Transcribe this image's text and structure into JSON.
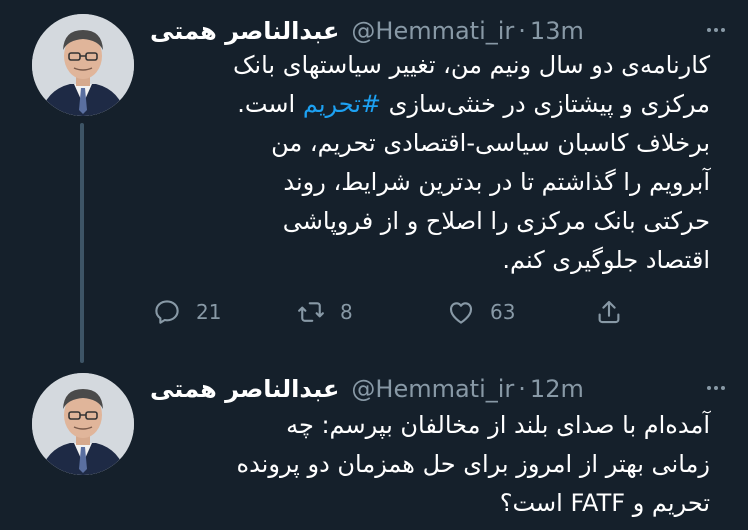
{
  "colors": {
    "background": "#15202b",
    "secondary_text": "#8899a6",
    "hashtag": "#1da1f2",
    "thread_line": "#3d5466"
  },
  "tweets": [
    {
      "display_name": "عبدالناصر همتی",
      "handle": "@Hemmati_ir",
      "separator": "·",
      "time": "13m",
      "body_lines": [
        "کارنامه‌ی دو سال ونیم من، تغییر سیاستهای بانک",
        "مرکزی و پیشتازی در خنثی‌سازی",
        "است.",
        "برخلاف کاسبان سیاسی-اقتصادی تحریم، من",
        "آبرویم را گذاشتم تا در بدترین شرایط، روند",
        "حرکتی بانک مرکزی را اصلاح و از فروپاشی",
        "اقتصاد جلوگیری کنم."
      ],
      "hashtag": "#تحریم",
      "actions": {
        "reply_icon": "reply-icon",
        "reply_count": "21",
        "retweet_icon": "retweet-icon",
        "retweet_count": "8",
        "like_icon": "heart-icon",
        "like_count": "63",
        "share_icon": "share-icon"
      }
    },
    {
      "display_name": "عبدالناصر همتی",
      "handle": "@Hemmati_ir",
      "separator": "·",
      "time": "12m",
      "body_lines": [
        "آمده‌ام با صدای بلند از مخالفان بپرسم: چه",
        "زمانی بهتر از امروز برای حل همزمان دو پرونده",
        "تحریم و FATF است؟"
      ]
    }
  ]
}
